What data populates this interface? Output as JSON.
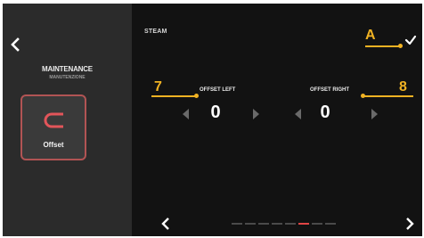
{
  "sidebar": {
    "title": "MAINTENANCE",
    "subtitle": "MANUTENZIONE",
    "tile_label": "Offset"
  },
  "header": {
    "section": "STEAM"
  },
  "offsets": {
    "left": {
      "label": "OFFSET LEFT",
      "value": "0"
    },
    "right": {
      "label": "OFFSET RIGHT",
      "value": "0"
    }
  },
  "callouts": {
    "a": "A",
    "left": "7",
    "right": "8"
  },
  "pagination": {
    "total": 8,
    "active_index": 5,
    "active_color": "#e04545"
  },
  "colors": {
    "accent": "#b15454",
    "callout": "#f0b223"
  },
  "icons": {
    "back": "chevron-left-icon",
    "confirm": "check-icon",
    "offset": "offset-icon",
    "prev": "chevron-left-icon",
    "next": "chevron-right-icon"
  }
}
